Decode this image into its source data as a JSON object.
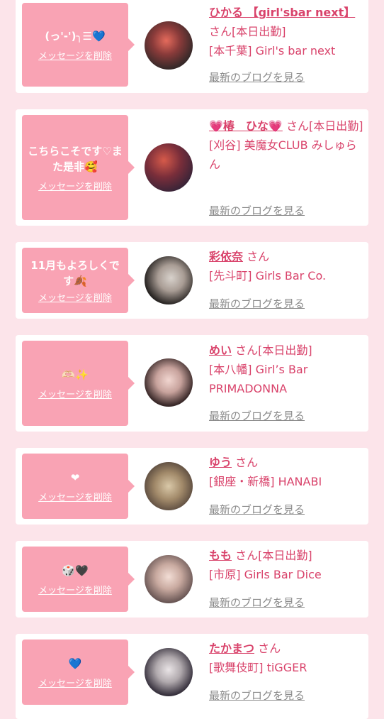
{
  "delete_label": "メッセージを削除",
  "blog_label": "最新のブログを見る",
  "san": "さん",
  "cards": [
    {
      "message": "(っ'-')╮☰💙",
      "name": "ひかる 【girl'sbar next】",
      "status": "[本日出勤]",
      "shop": "[本千葉] Girl's bar next"
    },
    {
      "message": "こちらこそです♡また是非🥰",
      "name": "💗椿　ひな💗",
      "status": "[本日出勤]",
      "shop": "[刈谷] 美魔女CLUB みしゅらん"
    },
    {
      "message": "11月もよろしくです🍂",
      "name": "彩依奈",
      "status": "",
      "shop": "[先斗町] Girls Bar Co."
    },
    {
      "message": "🫶🏻✨",
      "name": "めい",
      "status": "[本日出勤]",
      "shop": "[本八幡] Girl’s Bar PRIMADONNA"
    },
    {
      "message": "❤",
      "name": "ゆう",
      "status": "",
      "shop": "[銀座・新橋] HANABI"
    },
    {
      "message": "🎲🖤",
      "name": "もも",
      "status": "[本日出勤]",
      "shop": "[市原] Girls Bar Dice"
    },
    {
      "message": "💙",
      "name": "たかまつ",
      "status": "",
      "shop": "[歌舞伎町] tiGGER"
    }
  ],
  "colors": {
    "bubble": "#f9a3b4",
    "accent": "#d9436b",
    "background": "#fce4ea"
  }
}
